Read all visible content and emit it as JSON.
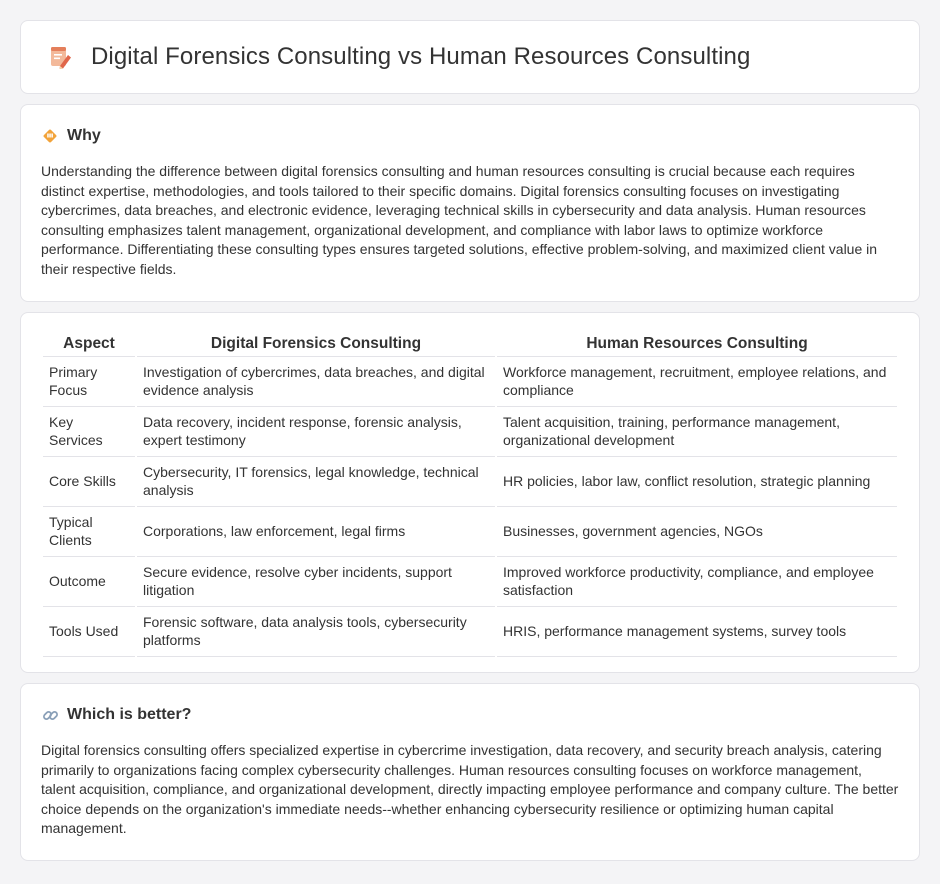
{
  "header": {
    "title": "Digital Forensics Consulting vs Human Resources Consulting",
    "icon": "document-pencil-icon"
  },
  "why": {
    "title": "Why",
    "icon": "diamond-warning-icon",
    "text": "Understanding the difference between digital forensics consulting and human resources consulting is crucial because each requires distinct expertise, methodologies, and tools tailored to their specific domains. Digital forensics consulting focuses on investigating cybercrimes, data breaches, and electronic evidence, leveraging technical skills in cybersecurity and data analysis. Human resources consulting emphasizes talent management, organizational development, and compliance with labor laws to optimize workforce performance. Differentiating these consulting types ensures targeted solutions, effective problem-solving, and maximized client value in their respective fields."
  },
  "table": {
    "headers": [
      "Aspect",
      "Digital Forensics Consulting",
      "Human Resources Consulting"
    ],
    "rows": [
      [
        "Primary Focus",
        "Investigation of cybercrimes, data breaches, and digital evidence analysis",
        "Workforce management, recruitment, employee relations, and compliance"
      ],
      [
        "Key Services",
        "Data recovery, incident response, forensic analysis, expert testimony",
        "Talent acquisition, training, performance management, organizational development"
      ],
      [
        "Core Skills",
        "Cybersecurity, IT forensics, legal knowledge, technical analysis",
        "HR policies, labor law, conflict resolution, strategic planning"
      ],
      [
        "Typical Clients",
        "Corporations, law enforcement, legal firms",
        "Businesses, government agencies, NGOs"
      ],
      [
        "Outcome",
        "Secure evidence, resolve cyber incidents, support litigation",
        "Improved workforce productivity, compliance, and employee satisfaction"
      ],
      [
        "Tools Used",
        "Forensic software, data analysis tools, cybersecurity platforms",
        "HRIS, performance management systems, survey tools"
      ]
    ]
  },
  "which": {
    "title": "Which is better?",
    "icon": "link-icon",
    "text": "Digital forensics consulting offers specialized expertise in cybercrime investigation, data recovery, and security breach analysis, catering primarily to organizations facing complex cybersecurity challenges. Human resources consulting focuses on workforce management, talent acquisition, compliance, and organizational development, directly impacting employee performance and company culture. The better choice depends on the organization's immediate needs--whether enhancing cybersecurity resilience or optimizing human capital management."
  },
  "colors": {
    "background": "#f4f4f6",
    "card": "#ffffff",
    "border": "#e3e3e8",
    "text": "#333333",
    "accent": "#e8864a"
  }
}
